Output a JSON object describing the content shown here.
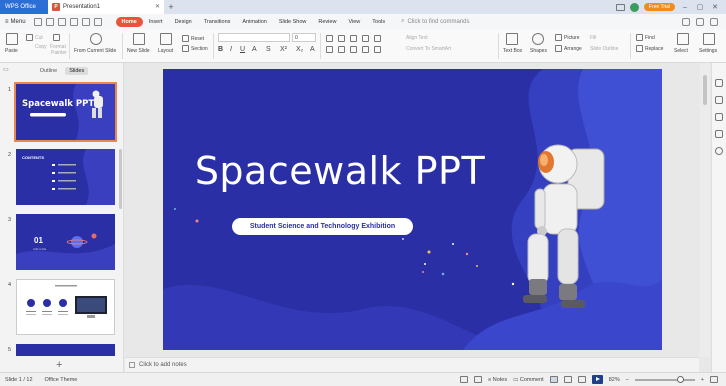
{
  "titlebar": {
    "app_tab": "WPS Office",
    "doc_tab": "Presentation1",
    "doc_icon_letter": "P",
    "free_trial": "Free Trial"
  },
  "menu": {
    "menu_label": "Menu",
    "tabs": [
      "Home",
      "Insert",
      "Design",
      "Transitions",
      "Animation",
      "Slide Show",
      "Review",
      "View",
      "Tools"
    ],
    "active_tab": "Home",
    "find_placeholder": "Click to find commands"
  },
  "ribbon": {
    "paste": "Paste",
    "cut": "Cut",
    "copy": "Copy",
    "format_painter_1": "Format",
    "format_painter_2": "Painter",
    "from_current_slide": "From Current Slide",
    "new_slide": "New Slide",
    "layout": "Layout",
    "reset": "Reset",
    "section": "Section",
    "font_size": "0",
    "align_text": "Align Text",
    "convert_smartart": "Convert To SmartArt",
    "text_box": "Text Box",
    "shapes": "Shapes",
    "picture": "Picture",
    "arrange": "Arrange",
    "fill": "Fill",
    "slide_outline": "Slide Outline",
    "find": "Find",
    "replace": "Replace",
    "select": "Select",
    "settings": "Settings"
  },
  "left_panel": {
    "tab_outline": "Outline",
    "tab_slides": "Slides",
    "slide_numbers": [
      "1",
      "2",
      "3",
      "4",
      "5"
    ],
    "thumb1_title": "Spacewalk PPT",
    "thumb2_title": "CONTENTS",
    "thumb3_number": "01",
    "thumb3_sub": "Add a title"
  },
  "slide": {
    "title": "Spacewalk PPT",
    "subtitle": "Student Science and Technology Exhibition"
  },
  "notes": {
    "placeholder": "Click to add notes"
  },
  "status": {
    "slide_counter": "Slide 1 / 12",
    "theme": "Office Theme",
    "notes_btn": "Notes",
    "comment_btn": "Comment",
    "zoom": "82%"
  },
  "colors": {
    "slide_bg": "#2b2fa6",
    "accent": "#e8543a",
    "wps_blue": "#2b6fd6"
  }
}
